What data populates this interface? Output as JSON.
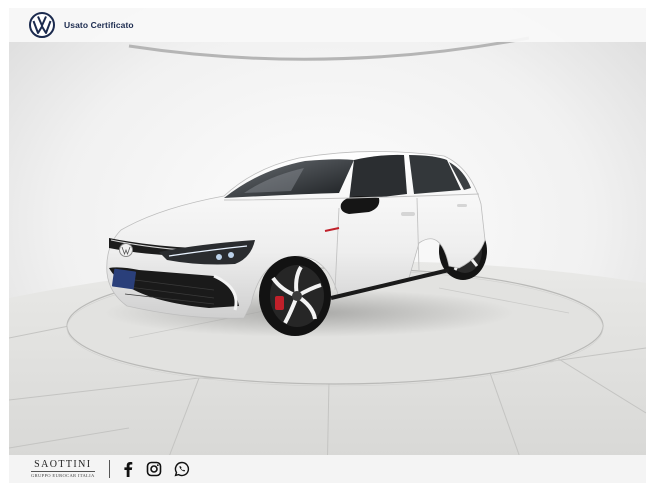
{
  "header": {
    "brand_label": "Usato Certificato",
    "logo_icon": "volkswagen-logo-icon"
  },
  "footer": {
    "dealer_name": "SAOTTINI",
    "dealer_subtitle": "GRUPPO EUROCAR ITALIA",
    "social_icons": [
      "facebook-icon",
      "instagram-icon",
      "whatsapp-icon"
    ]
  },
  "colors": {
    "brand_navy": "#1b2a4e",
    "car_body": "#f2f2f2",
    "studio_floor": "#dcdcda",
    "brake_caliper": "#c0202a"
  }
}
